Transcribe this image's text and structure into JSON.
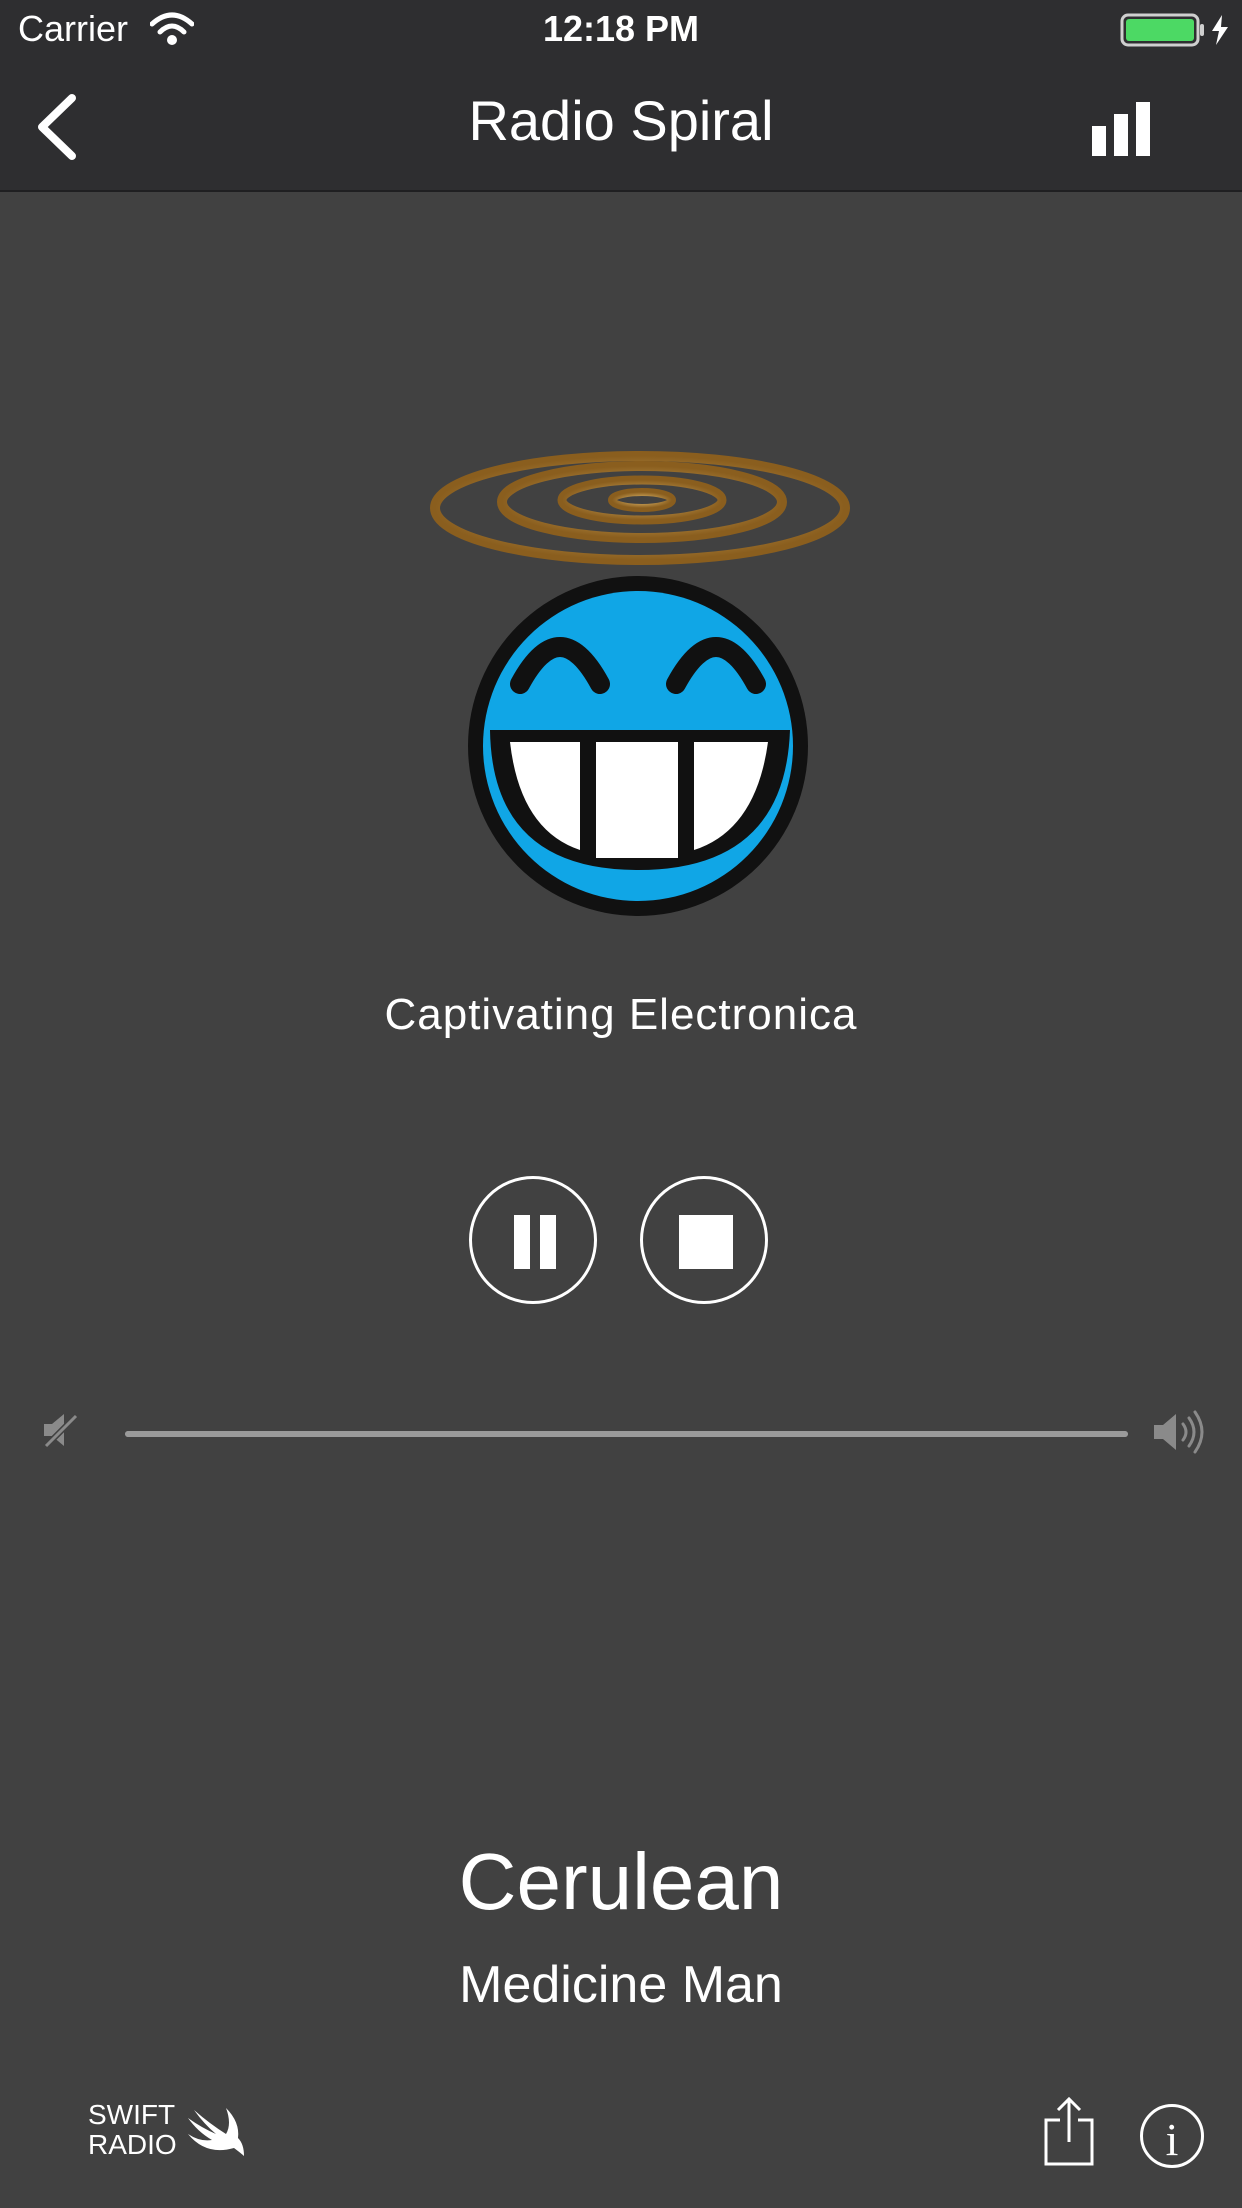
{
  "status_bar": {
    "carrier": "Carrier",
    "time": "12:18 PM",
    "battery_color": "#4cd964"
  },
  "nav": {
    "title": "Radio Spiral"
  },
  "station": {
    "description": "Captivating Electronica",
    "logo_colors": {
      "face": "#10a6e6",
      "halo": "#c9953d"
    }
  },
  "controls": {
    "pause": "pause-icon",
    "stop": "stop-icon"
  },
  "volume": {
    "level": 1.0
  },
  "now_playing": {
    "title": "Cerulean",
    "artist": "Medicine Man"
  },
  "footer": {
    "logo_line1": "SWIFT",
    "logo_line2": "RADIO"
  }
}
